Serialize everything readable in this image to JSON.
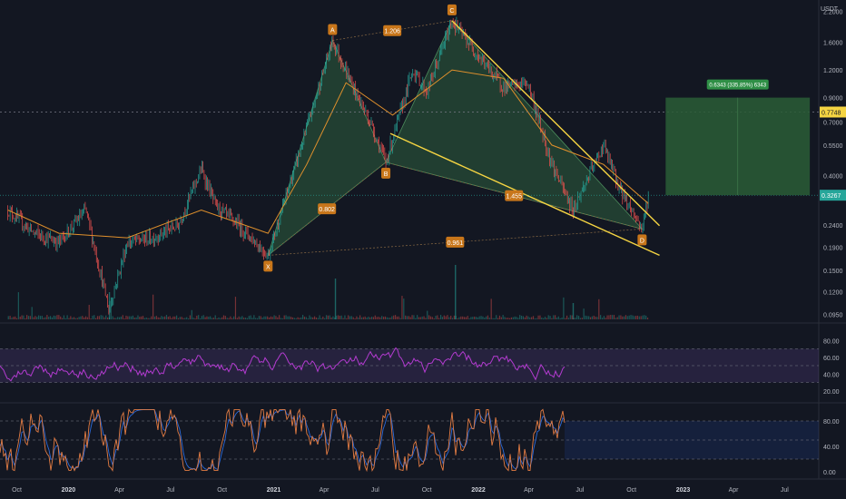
{
  "currency": "USDT",
  "price_axis": {
    "ticks": [
      "2.2000",
      "1.6000",
      "1.2000",
      "0.9000",
      "0.7000",
      "0.5500",
      "0.4000",
      "0.2400",
      "0.1900",
      "0.1500",
      "0.1200",
      "0.0950"
    ],
    "tick_values": [
      2.2,
      1.6,
      1.2,
      0.9,
      0.7,
      0.55,
      0.4,
      0.24,
      0.19,
      0.15,
      0.12,
      0.095
    ],
    "scale": "log",
    "current_price_label": "0.3267",
    "horizontal_level_label": "0.7748"
  },
  "time_axis": {
    "labels": [
      "Oct",
      "2020",
      "Apr",
      "Jul",
      "Oct",
      "2021",
      "Apr",
      "Jul",
      "Oct",
      "2022",
      "Apr",
      "Jul",
      "Oct",
      "2023",
      "Apr",
      "Jul"
    ],
    "bold": [
      "2020",
      "2021",
      "2022",
      "2023"
    ]
  },
  "harmonic_pattern": {
    "points": [
      {
        "label": "X",
        "date": "2020-12-22",
        "price": 0.175
      },
      {
        "label": "A",
        "date": "2021-04-16",
        "price": 1.63
      },
      {
        "label": "B",
        "date": "2021-07-20",
        "price": 0.46
      },
      {
        "label": "C",
        "date": "2021-11-15",
        "price": 2.0
      },
      {
        "label": "D",
        "date": "2022-10-20",
        "price": 0.23
      }
    ],
    "ratios": [
      {
        "label": "1.206",
        "between": "A-C"
      },
      {
        "label": "0.802",
        "between": "X-B"
      },
      {
        "label": "1.455",
        "between": "B-D"
      },
      {
        "label": "0.961",
        "between": "X-D"
      }
    ]
  },
  "position_box": {
    "label": "0.6343 (335.85%) 6343"
  },
  "rsi_panel": {
    "ticks": [
      "80.00",
      "60.00",
      "40.00",
      "20.00"
    ],
    "tick_values": [
      80,
      60,
      40,
      20
    ],
    "band_upper": 70,
    "band_lower": 30
  },
  "stoch_panel": {
    "ticks": [
      "80.00",
      "40.00",
      "0.00"
    ],
    "tick_values": [
      80,
      40,
      0
    ],
    "levels": [
      80,
      50,
      20
    ]
  },
  "colors": {
    "background": "#131722",
    "candle_up": "#26a69a",
    "candle_down": "#ef5350",
    "ma_line": "#e0902c",
    "pattern_fill": "#2e5f3e",
    "trendline": "#f5d442",
    "label_orange": "#c8761a",
    "rsi_line": "#b33bd0",
    "stoch_k": "#e37c43",
    "stoch_d": "#2b6ad9",
    "position_box": "#2a5d36",
    "price_label": "#f5d442"
  },
  "chart_data": {
    "type": "line",
    "title": "",
    "xlabel": "",
    "ylabel": "",
    "ylim": [
      0.09,
      2.3
    ],
    "x_start": "2019-09-01",
    "x_end": "2023-08-31",
    "price_series_approx": {
      "name": "",
      "x": [
        "2019-09-15",
        "2019-11-01",
        "2019-12-15",
        "2020-02-01",
        "2020-03-13",
        "2020-04-15",
        "2020-06-01",
        "2020-07-15",
        "2020-08-25",
        "2020-09-20",
        "2020-10-30",
        "2020-12-22",
        "2021-02-20",
        "2021-04-16",
        "2021-05-23",
        "2021-06-22",
        "2021-07-20",
        "2021-09-06",
        "2021-10-01",
        "2021-11-15",
        "2021-12-31",
        "2022-02-15",
        "2022-03-30",
        "2022-05-12",
        "2022-06-18",
        "2022-08-12",
        "2022-09-10",
        "2022-10-20",
        "2022-10-31"
      ],
      "values": [
        0.28,
        0.22,
        0.2,
        0.28,
        0.1,
        0.2,
        0.21,
        0.24,
        0.43,
        0.29,
        0.24,
        0.175,
        0.55,
        1.63,
        1.0,
        0.7,
        0.46,
        1.2,
        0.95,
        2.0,
        1.4,
        1.0,
        1.05,
        0.45,
        0.28,
        0.55,
        0.35,
        0.23,
        0.3267
      ]
    },
    "ma_series_approx": {
      "name": "",
      "x": [
        "2019-09-15",
        "2019-12-15",
        "2020-04-15",
        "2020-08-25",
        "2020-12-22",
        "2021-03-01",
        "2021-05-10",
        "2021-08-01",
        "2021-11-15",
        "2022-02-15",
        "2022-05-12",
        "2022-08-12",
        "2022-10-31"
      ],
      "values": [
        0.28,
        0.22,
        0.21,
        0.28,
        0.22,
        0.45,
        1.05,
        0.75,
        1.2,
        1.1,
        0.55,
        0.45,
        0.3
      ]
    },
    "position_box": {
      "x_start": "2022-12-01",
      "x_end": "2023-08-15",
      "y_bottom": 0.3267,
      "y_top": 0.9
    }
  }
}
